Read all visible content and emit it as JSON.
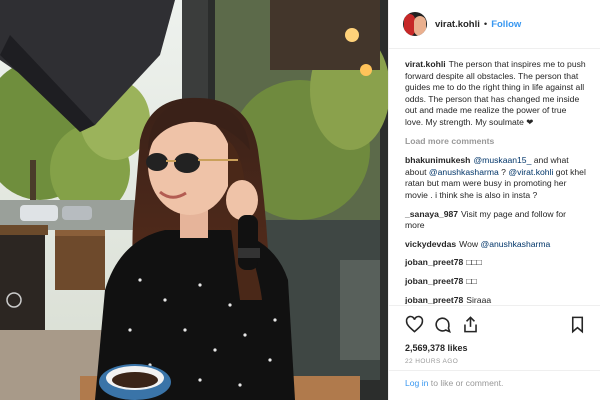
{
  "post": {
    "photo_icon": "photo",
    "header": {
      "avatar_icon": "avatar-icon",
      "username": "virat.kohli",
      "separator": "•",
      "follow_label": "Follow"
    },
    "caption": {
      "user": "virat.kohli",
      "text": "The person that inspires me to push forward despite all obstacles. The person that guides me to do the right thing in life against all odds. The person that has changed me inside out and made me realize the power of true love. My strength. My soulmate ❤"
    },
    "load_more_label": "Load more comments",
    "comments": [
      {
        "user": "bhakunimukesh",
        "parts": [
          {
            "t": "@muskaan15_",
            "m": true
          },
          {
            "t": " and what about ",
            "m": false
          },
          {
            "t": "@anushkasharma",
            "m": true
          },
          {
            "t": " ? ",
            "m": false
          },
          {
            "t": "@virat.kohli",
            "m": true
          },
          {
            "t": " got khel ratan but mam were busy in promoting her movie . i think she is also in insta ?",
            "m": false
          }
        ]
      },
      {
        "user": "_sanaya_987",
        "parts": [
          {
            "t": "Visit my page and follow for more",
            "m": false
          }
        ]
      },
      {
        "user": "vickydevdas",
        "parts": [
          {
            "t": "Wow ",
            "m": false
          },
          {
            "t": "@anushkasharma",
            "m": true
          }
        ]
      },
      {
        "user": "joban_preet78",
        "parts": [
          {
            "t": "□□□",
            "m": false
          }
        ]
      },
      {
        "user": "joban_preet78",
        "parts": [
          {
            "t": "□□",
            "m": false
          }
        ]
      },
      {
        "user": "joban_preet78",
        "parts": [
          {
            "t": "Siraaa",
            "m": false
          }
        ]
      }
    ],
    "actions": {
      "icons": [
        "heart-icon",
        "comment-icon",
        "share-icon",
        "bookmark-icon"
      ]
    },
    "likes": "2,569,378 likes",
    "time": "22 HOURS AGO",
    "login": {
      "link": "Log in",
      "text": " to like or comment."
    },
    "colors": {
      "link": "#3897f0",
      "mention": "#003569",
      "muted": "#999999",
      "text": "#262626"
    }
  }
}
